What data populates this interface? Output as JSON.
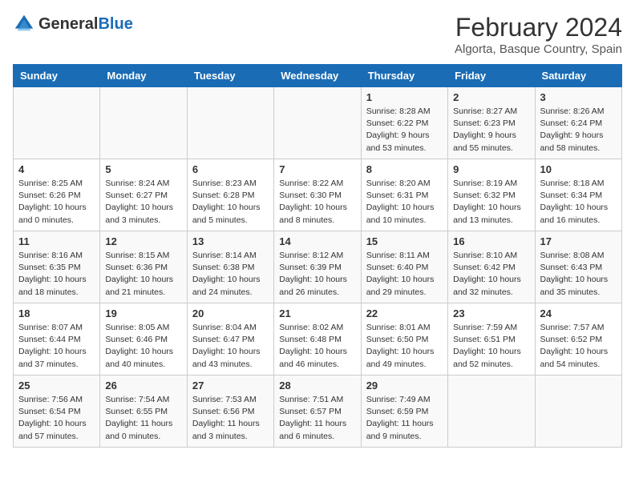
{
  "header": {
    "logo_general": "General",
    "logo_blue": "Blue",
    "month_year": "February 2024",
    "location": "Algorta, Basque Country, Spain"
  },
  "days_of_week": [
    "Sunday",
    "Monday",
    "Tuesday",
    "Wednesday",
    "Thursday",
    "Friday",
    "Saturday"
  ],
  "weeks": [
    [
      {
        "day": "",
        "info": ""
      },
      {
        "day": "",
        "info": ""
      },
      {
        "day": "",
        "info": ""
      },
      {
        "day": "",
        "info": ""
      },
      {
        "day": "1",
        "info": "Sunrise: 8:28 AM\nSunset: 6:22 PM\nDaylight: 9 hours\nand 53 minutes."
      },
      {
        "day": "2",
        "info": "Sunrise: 8:27 AM\nSunset: 6:23 PM\nDaylight: 9 hours\nand 55 minutes."
      },
      {
        "day": "3",
        "info": "Sunrise: 8:26 AM\nSunset: 6:24 PM\nDaylight: 9 hours\nand 58 minutes."
      }
    ],
    [
      {
        "day": "4",
        "info": "Sunrise: 8:25 AM\nSunset: 6:26 PM\nDaylight: 10 hours\nand 0 minutes."
      },
      {
        "day": "5",
        "info": "Sunrise: 8:24 AM\nSunset: 6:27 PM\nDaylight: 10 hours\nand 3 minutes."
      },
      {
        "day": "6",
        "info": "Sunrise: 8:23 AM\nSunset: 6:28 PM\nDaylight: 10 hours\nand 5 minutes."
      },
      {
        "day": "7",
        "info": "Sunrise: 8:22 AM\nSunset: 6:30 PM\nDaylight: 10 hours\nand 8 minutes."
      },
      {
        "day": "8",
        "info": "Sunrise: 8:20 AM\nSunset: 6:31 PM\nDaylight: 10 hours\nand 10 minutes."
      },
      {
        "day": "9",
        "info": "Sunrise: 8:19 AM\nSunset: 6:32 PM\nDaylight: 10 hours\nand 13 minutes."
      },
      {
        "day": "10",
        "info": "Sunrise: 8:18 AM\nSunset: 6:34 PM\nDaylight: 10 hours\nand 16 minutes."
      }
    ],
    [
      {
        "day": "11",
        "info": "Sunrise: 8:16 AM\nSunset: 6:35 PM\nDaylight: 10 hours\nand 18 minutes."
      },
      {
        "day": "12",
        "info": "Sunrise: 8:15 AM\nSunset: 6:36 PM\nDaylight: 10 hours\nand 21 minutes."
      },
      {
        "day": "13",
        "info": "Sunrise: 8:14 AM\nSunset: 6:38 PM\nDaylight: 10 hours\nand 24 minutes."
      },
      {
        "day": "14",
        "info": "Sunrise: 8:12 AM\nSunset: 6:39 PM\nDaylight: 10 hours\nand 26 minutes."
      },
      {
        "day": "15",
        "info": "Sunrise: 8:11 AM\nSunset: 6:40 PM\nDaylight: 10 hours\nand 29 minutes."
      },
      {
        "day": "16",
        "info": "Sunrise: 8:10 AM\nSunset: 6:42 PM\nDaylight: 10 hours\nand 32 minutes."
      },
      {
        "day": "17",
        "info": "Sunrise: 8:08 AM\nSunset: 6:43 PM\nDaylight: 10 hours\nand 35 minutes."
      }
    ],
    [
      {
        "day": "18",
        "info": "Sunrise: 8:07 AM\nSunset: 6:44 PM\nDaylight: 10 hours\nand 37 minutes."
      },
      {
        "day": "19",
        "info": "Sunrise: 8:05 AM\nSunset: 6:46 PM\nDaylight: 10 hours\nand 40 minutes."
      },
      {
        "day": "20",
        "info": "Sunrise: 8:04 AM\nSunset: 6:47 PM\nDaylight: 10 hours\nand 43 minutes."
      },
      {
        "day": "21",
        "info": "Sunrise: 8:02 AM\nSunset: 6:48 PM\nDaylight: 10 hours\nand 46 minutes."
      },
      {
        "day": "22",
        "info": "Sunrise: 8:01 AM\nSunset: 6:50 PM\nDaylight: 10 hours\nand 49 minutes."
      },
      {
        "day": "23",
        "info": "Sunrise: 7:59 AM\nSunset: 6:51 PM\nDaylight: 10 hours\nand 52 minutes."
      },
      {
        "day": "24",
        "info": "Sunrise: 7:57 AM\nSunset: 6:52 PM\nDaylight: 10 hours\nand 54 minutes."
      }
    ],
    [
      {
        "day": "25",
        "info": "Sunrise: 7:56 AM\nSunset: 6:54 PM\nDaylight: 10 hours\nand 57 minutes."
      },
      {
        "day": "26",
        "info": "Sunrise: 7:54 AM\nSunset: 6:55 PM\nDaylight: 11 hours\nand 0 minutes."
      },
      {
        "day": "27",
        "info": "Sunrise: 7:53 AM\nSunset: 6:56 PM\nDaylight: 11 hours\nand 3 minutes."
      },
      {
        "day": "28",
        "info": "Sunrise: 7:51 AM\nSunset: 6:57 PM\nDaylight: 11 hours\nand 6 minutes."
      },
      {
        "day": "29",
        "info": "Sunrise: 7:49 AM\nSunset: 6:59 PM\nDaylight: 11 hours\nand 9 minutes."
      },
      {
        "day": "",
        "info": ""
      },
      {
        "day": "",
        "info": ""
      }
    ]
  ]
}
